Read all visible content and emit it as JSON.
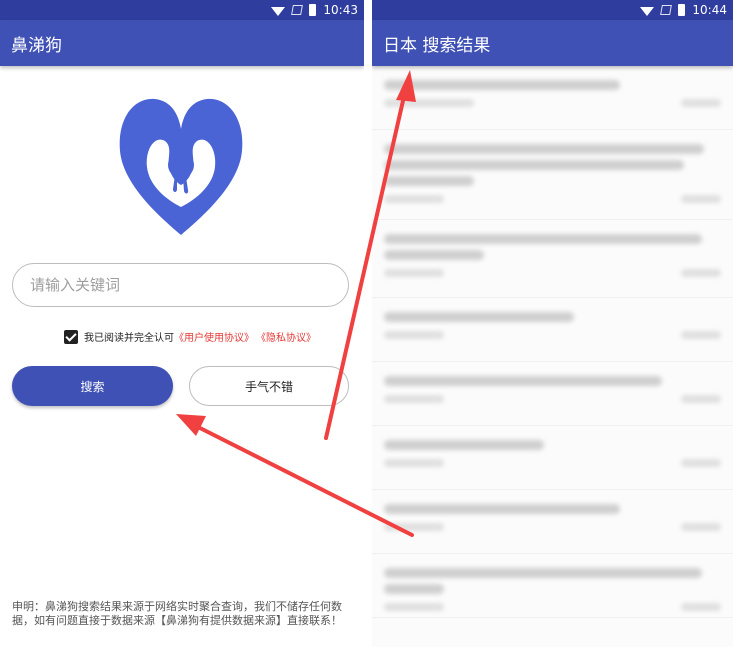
{
  "status_left": {
    "time": "10:43"
  },
  "status_right": {
    "time": "10:44"
  },
  "left_app": {
    "title": "鼻涕狗",
    "search_placeholder": "请输入关键词",
    "agree_text": "我已阅读并完全认可",
    "user_agreement": "《用户使用协议》",
    "privacy_agreement": "《隐私协议》",
    "search_button": "搜索",
    "lucky_button": "手气不错",
    "disclaimer": "申明：鼻涕狗搜索结果来源于网络实时聚合查询，我们不储存任何数据，如有问题直接于数据来源【鼻涕狗有提供数据来源】直接联系！"
  },
  "right_app": {
    "title": "日本 搜索结果"
  },
  "colors": {
    "appbar": "#3f51b5",
    "statusbar": "#2f3e9e",
    "logo": "#4a64d6",
    "link": "#e53935",
    "arrow": "#f04040"
  },
  "icons": [
    "wifi-icon",
    "signal-icon",
    "battery-icon",
    "checkbox-icon",
    "app-logo-icon"
  ]
}
